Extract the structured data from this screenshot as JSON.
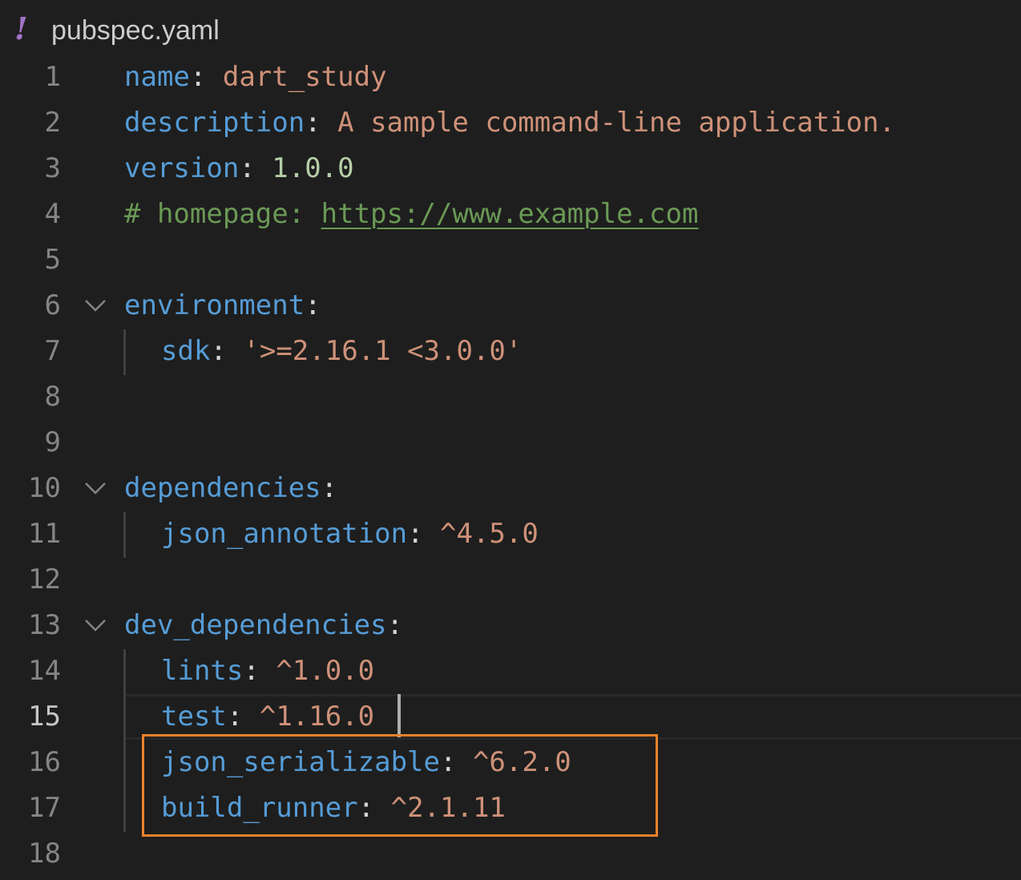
{
  "tab": {
    "icon": "yaml-exclamation-icon",
    "icon_glyph": "!",
    "file_name": "pubspec.yaml"
  },
  "lines": [
    {
      "num": "1",
      "key": "name",
      "sep": ": ",
      "value": "dart_study"
    },
    {
      "num": "2",
      "key": "description",
      "sep": ": ",
      "value": "A sample command-line application."
    },
    {
      "num": "3",
      "key": "version",
      "sep": ": ",
      "value": "1.0.0"
    },
    {
      "num": "4",
      "comment_prefix": "# homepage: ",
      "comment_url": "https://www.example.com"
    },
    {
      "num": "5"
    },
    {
      "num": "6",
      "key": "environment",
      "sep": ":"
    },
    {
      "num": "7",
      "key": "sdk",
      "sep": ": ",
      "value": "'>=2.16.1 <3.0.0'"
    },
    {
      "num": "8"
    },
    {
      "num": "9"
    },
    {
      "num": "10",
      "key": "dependencies",
      "sep": ":"
    },
    {
      "num": "11",
      "key": "json_annotation",
      "sep": ": ",
      "value": "^4.5.0"
    },
    {
      "num": "12"
    },
    {
      "num": "13",
      "key": "dev_dependencies",
      "sep": ":"
    },
    {
      "num": "14",
      "key": "lints",
      "sep": ": ",
      "value": "^1.0.0"
    },
    {
      "num": "15",
      "key": "test",
      "sep": ": ",
      "value": "^1.16.0"
    },
    {
      "num": "16",
      "key": "json_serializable",
      "sep": ": ",
      "value": "^6.2.0"
    },
    {
      "num": "17",
      "key": "build_runner",
      "sep": ": ",
      "value": "^2.1.11"
    },
    {
      "num": "18"
    }
  ],
  "current_line": "15",
  "highlight_color": "#f0822a",
  "colors": {
    "background": "#1e1e1e",
    "key": "#569cd6",
    "string": "#ce9178",
    "number": "#b5cea8",
    "comment": "#6a9955"
  }
}
